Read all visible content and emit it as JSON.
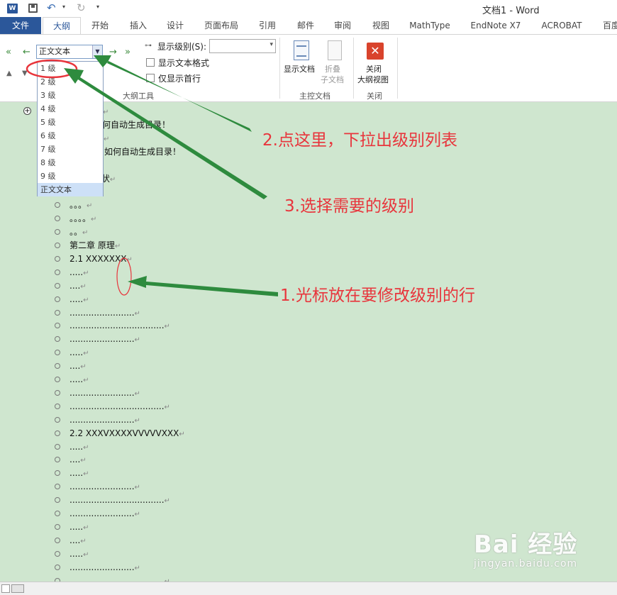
{
  "title_bar": {
    "app_icon": "W",
    "window_title": "文档1 - Word"
  },
  "tabs": [
    "文件",
    "大纲",
    "开始",
    "插入",
    "设计",
    "页面布局",
    "引用",
    "邮件",
    "审阅",
    "视图",
    "MathType",
    "EndNote X7",
    "ACROBAT",
    "百度"
  ],
  "ribbon": {
    "level_select_value": "正文文本",
    "show_level_label": "显示级别(S):",
    "show_text_format": "显示文本格式",
    "show_first_line": "仅显示首行",
    "outline_tools_group": "大纲工具",
    "show_document": "显示文档",
    "collapse_subdocs": [
      "折叠",
      "子文档"
    ],
    "master_doc_group": "主控文档",
    "close_outline": [
      "关闭",
      "大纲视图"
    ],
    "close_group": "关闭"
  },
  "level_dropdown": {
    "items": [
      "1 级",
      "2 级",
      "3 级",
      "4 级",
      "5 级",
      "6 级",
      "7 级",
      "8 级",
      "9 级",
      "正文文本"
    ],
    "selected_index": 9
  },
  "outline": [
    {
      "text": "",
      "mark": "↵",
      "kind": "plus"
    },
    {
      "text": "何自动生成目录！",
      "mark": "",
      "kind": "none"
    },
    {
      "text": "",
      "mark": "↵",
      "kind": "none"
    },
    {
      "text": "如何自动生成目录！",
      "mark": "",
      "kind": "none"
    },
    {
      "text": "。。。",
      "mark": "↵",
      "kind": "bullet"
    },
    {
      "text": "1.2 研究现状",
      "mark": "↵",
      "kind": "plus"
    },
    {
      "text": "。。。。。",
      "mark": "↵",
      "kind": "bullet"
    },
    {
      "text": "。。。",
      "mark": "↵",
      "kind": "bullet"
    },
    {
      "text": "。。。。",
      "mark": "↵",
      "kind": "bullet"
    },
    {
      "text": "。。",
      "mark": "↵",
      "kind": "bullet"
    },
    {
      "text": "第二章 原理",
      "mark": "↵",
      "kind": "bullet"
    },
    {
      "text": "2.1 XXXXXXX",
      "mark": "↵",
      "kind": "bullet"
    },
    {
      "text": ".....",
      "mark": "↵",
      "kind": "bullet"
    },
    {
      "text": "....",
      "mark": "↵",
      "kind": "bullet"
    },
    {
      "text": ".....",
      "mark": "↵",
      "kind": "bullet"
    },
    {
      "text": "........................",
      "mark": "↵",
      "kind": "bullet"
    },
    {
      "text": "...................................",
      "mark": "↵",
      "kind": "bullet"
    },
    {
      "text": "........................",
      "mark": "↵",
      "kind": "bullet"
    },
    {
      "text": ".....",
      "mark": "↵",
      "kind": "bullet"
    },
    {
      "text": "....",
      "mark": "↵",
      "kind": "bullet"
    },
    {
      "text": ".....",
      "mark": "↵",
      "kind": "bullet"
    },
    {
      "text": "........................",
      "mark": "↵",
      "kind": "bullet"
    },
    {
      "text": "...................................",
      "mark": "↵",
      "kind": "bullet"
    },
    {
      "text": "........................",
      "mark": "↵",
      "kind": "bullet"
    },
    {
      "text": "2.2 XXXVXXXXVVVVVXXX",
      "mark": "↵",
      "kind": "bullet"
    },
    {
      "text": ".....",
      "mark": "↵",
      "kind": "bullet"
    },
    {
      "text": "....",
      "mark": "↵",
      "kind": "bullet"
    },
    {
      "text": ".....",
      "mark": "↵",
      "kind": "bullet"
    },
    {
      "text": "........................",
      "mark": "↵",
      "kind": "bullet"
    },
    {
      "text": "...................................",
      "mark": "↵",
      "kind": "bullet"
    },
    {
      "text": "........................",
      "mark": "↵",
      "kind": "bullet"
    },
    {
      "text": ".....",
      "mark": "↵",
      "kind": "bullet"
    },
    {
      "text": "....",
      "mark": "↵",
      "kind": "bullet"
    },
    {
      "text": ".....",
      "mark": "↵",
      "kind": "bullet"
    },
    {
      "text": "........................",
      "mark": "↵",
      "kind": "bullet"
    },
    {
      "text": "...................................",
      "mark": "↵",
      "kind": "bullet"
    }
  ],
  "annotations": {
    "step1": "1.光标放在要修改级别的行",
    "step2": "2.点这里，下拉出级别列表",
    "step3": "3.选择需要的级别",
    "color": "#e8353c",
    "arrow_color": "#2e8b3e"
  },
  "watermark": {
    "logo": "Bai 经验",
    "url": "jingyan.baidu.com"
  },
  "colors": {
    "accent": "#2b579a",
    "doc_background": "#cfe6cf"
  }
}
